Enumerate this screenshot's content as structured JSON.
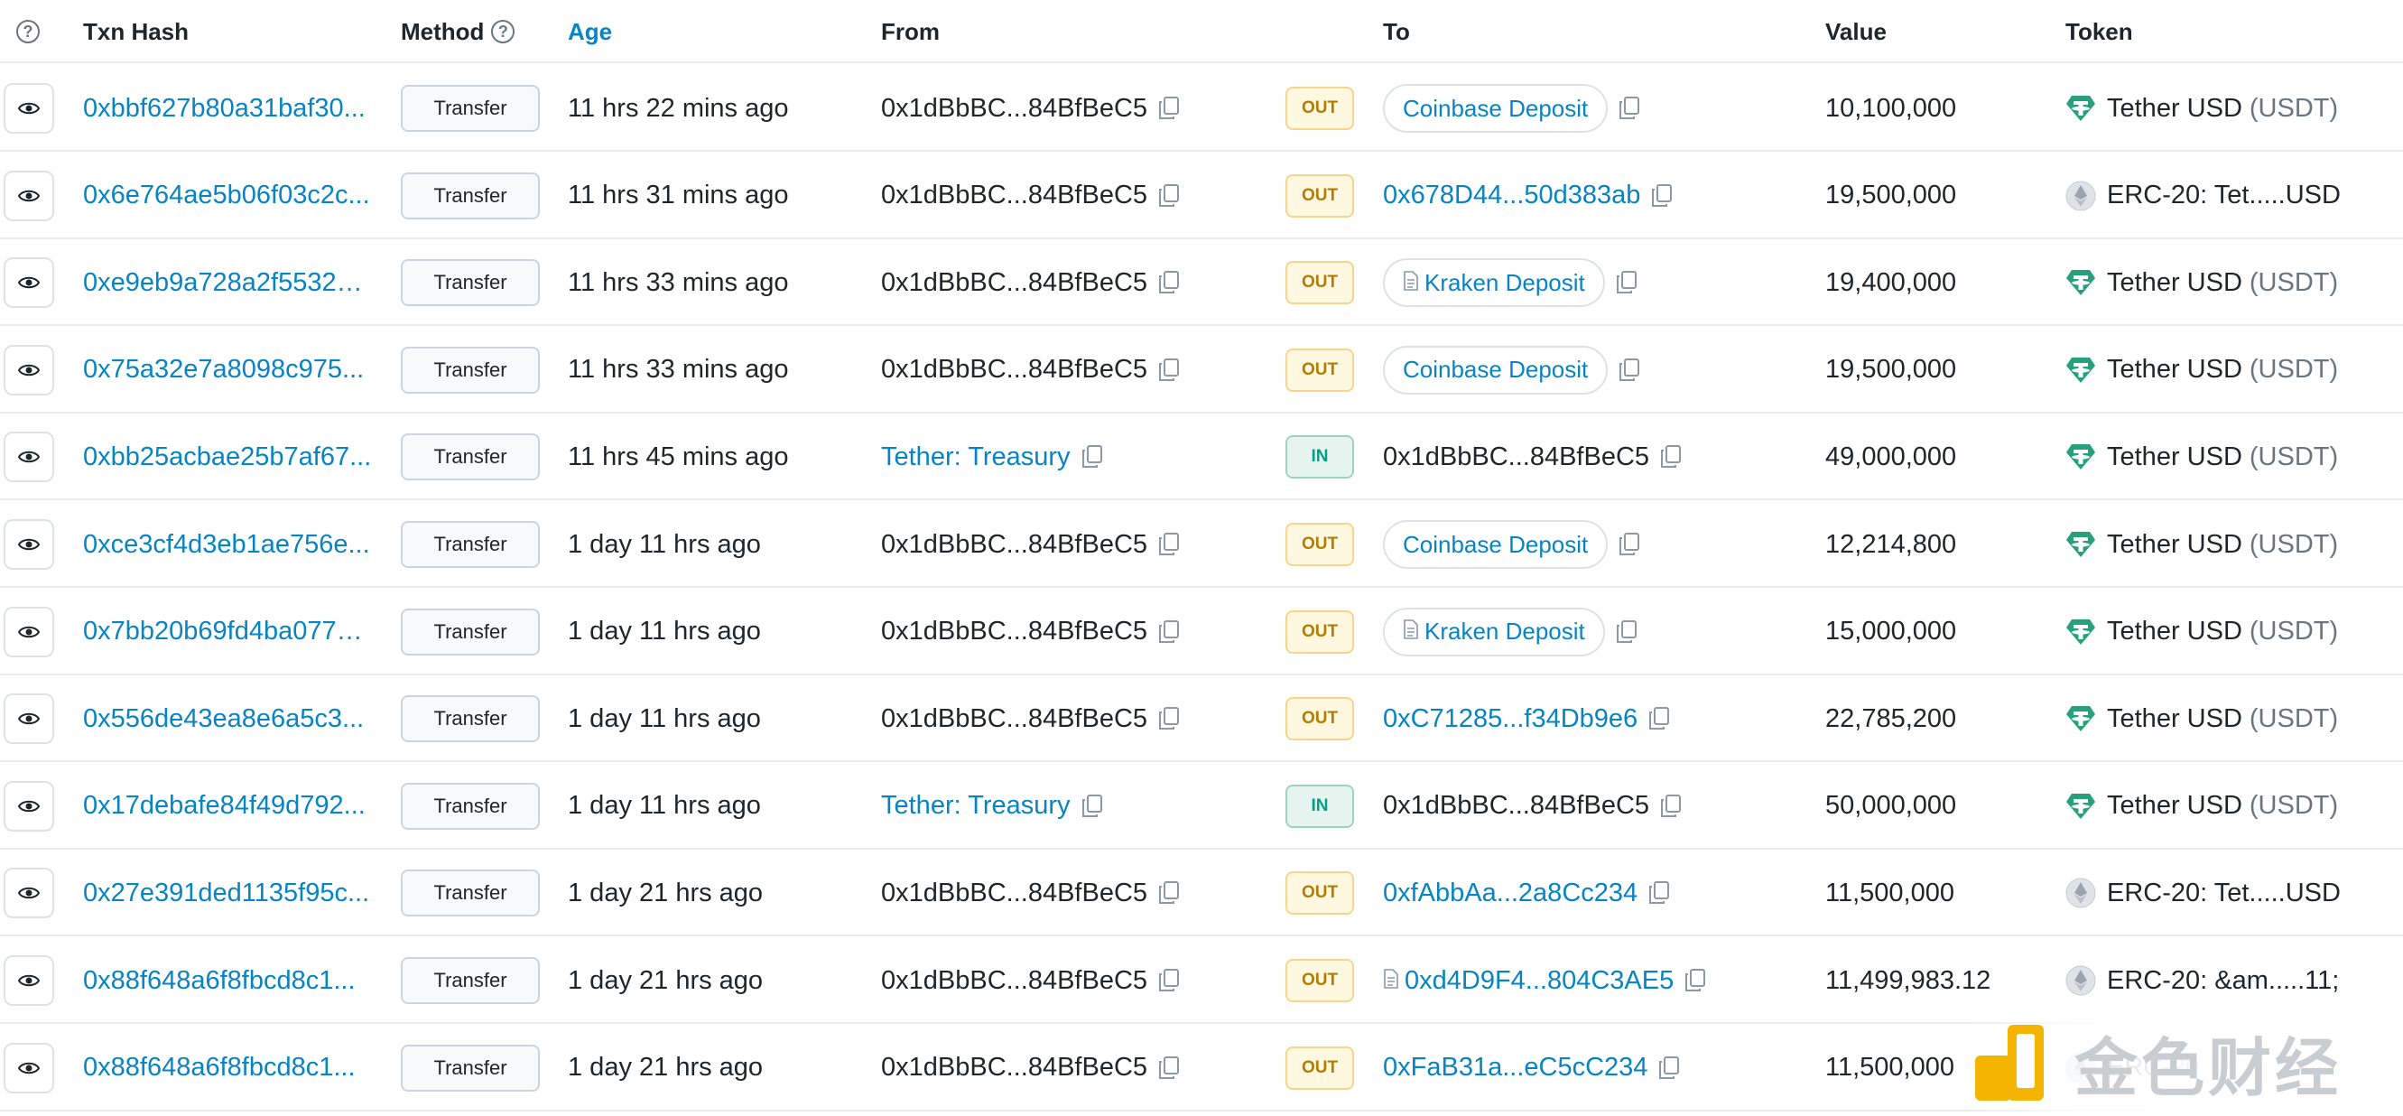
{
  "columns": {
    "help": "?",
    "txn_hash": "Txn Hash",
    "method": "Method",
    "age": "Age",
    "from": "From",
    "to": "To",
    "value": "Value",
    "token": "Token"
  },
  "rows": [
    {
      "hash": "0xbbf627b80a31baf30...",
      "method": "Transfer",
      "age": "11 hrs 22 mins ago",
      "from": "0x1dBbBC...84BfBeC5",
      "from_link": false,
      "dir": "OUT",
      "to": "Coinbase Deposit",
      "to_type": "pill",
      "value": "10,100,000",
      "token_type": "tether",
      "token_name": "Tether USD",
      "token_sym": "(USDT)"
    },
    {
      "hash": "0x6e764ae5b06f03c2c...",
      "method": "Transfer",
      "age": "11 hrs 31 mins ago",
      "from": "0x1dBbBC...84BfBeC5",
      "from_link": false,
      "dir": "OUT",
      "to": "0x678D44...50d383ab",
      "to_type": "link",
      "value": "19,500,000",
      "token_type": "erc20",
      "token_name": "ERC-20: Tet.....USD",
      "token_sym": ""
    },
    {
      "hash": "0xe9eb9a728a2f55325...",
      "method": "Transfer",
      "age": "11 hrs 33 mins ago",
      "from": "0x1dBbBC...84BfBeC5",
      "from_link": false,
      "dir": "OUT",
      "to": "Kraken Deposit",
      "to_type": "pill-doc",
      "value": "19,400,000",
      "token_type": "tether",
      "token_name": "Tether USD",
      "token_sym": "(USDT)"
    },
    {
      "hash": "0x75a32e7a8098c975...",
      "method": "Transfer",
      "age": "11 hrs 33 mins ago",
      "from": "0x1dBbBC...84BfBeC5",
      "from_link": false,
      "dir": "OUT",
      "to": "Coinbase Deposit",
      "to_type": "pill",
      "value": "19,500,000",
      "token_type": "tether",
      "token_name": "Tether USD",
      "token_sym": "(USDT)"
    },
    {
      "hash": "0xbb25acbae25b7af67...",
      "method": "Transfer",
      "age": "11 hrs 45 mins ago",
      "from": "Tether: Treasury",
      "from_link": true,
      "dir": "IN",
      "to": "0x1dBbBC...84BfBeC5",
      "to_type": "plain",
      "value": "49,000,000",
      "token_type": "tether",
      "token_name": "Tether USD",
      "token_sym": "(USDT)"
    },
    {
      "hash": "0xce3cf4d3eb1ae756e...",
      "method": "Transfer",
      "age": "1 day 11 hrs ago",
      "from": "0x1dBbBC...84BfBeC5",
      "from_link": false,
      "dir": "OUT",
      "to": "Coinbase Deposit",
      "to_type": "pill",
      "value": "12,214,800",
      "token_type": "tether",
      "token_name": "Tether USD",
      "token_sym": "(USDT)"
    },
    {
      "hash": "0x7bb20b69fd4ba0779...",
      "method": "Transfer",
      "age": "1 day 11 hrs ago",
      "from": "0x1dBbBC...84BfBeC5",
      "from_link": false,
      "dir": "OUT",
      "to": "Kraken Deposit",
      "to_type": "pill-doc",
      "value": "15,000,000",
      "token_type": "tether",
      "token_name": "Tether USD",
      "token_sym": "(USDT)"
    },
    {
      "hash": "0x556de43ea8e6a5c3...",
      "method": "Transfer",
      "age": "1 day 11 hrs ago",
      "from": "0x1dBbBC...84BfBeC5",
      "from_link": false,
      "dir": "OUT",
      "to": "0xC71285...f34Db9e6",
      "to_type": "link",
      "value": "22,785,200",
      "token_type": "tether",
      "token_name": "Tether USD",
      "token_sym": "(USDT)"
    },
    {
      "hash": "0x17debafe84f49d792...",
      "method": "Transfer",
      "age": "1 day 11 hrs ago",
      "from": "Tether: Treasury",
      "from_link": true,
      "dir": "IN",
      "to": "0x1dBbBC...84BfBeC5",
      "to_type": "plain",
      "value": "50,000,000",
      "token_type": "tether",
      "token_name": "Tether USD",
      "token_sym": "(USDT)"
    },
    {
      "hash": "0x27e391ded1135f95c...",
      "method": "Transfer",
      "age": "1 day 21 hrs ago",
      "from": "0x1dBbBC...84BfBeC5",
      "from_link": false,
      "dir": "OUT",
      "to": "0xfAbbAa...2a8Cc234",
      "to_type": "link",
      "value": "11,500,000",
      "token_type": "erc20",
      "token_name": "ERC-20: Tet.....USD",
      "token_sym": ""
    },
    {
      "hash": "0x88f648a6f8fbcd8c1...",
      "method": "Transfer",
      "age": "1 day 21 hrs ago",
      "from": "0x1dBbBC...84BfBeC5",
      "from_link": false,
      "dir": "OUT",
      "to": "0xd4D9F4...804C3AE5",
      "to_type": "link-doc",
      "value": "11,499,983.12",
      "token_type": "erc20",
      "token_name": "ERC-20: &am.....11;",
      "token_sym": ""
    },
    {
      "hash": "0x88f648a6f8fbcd8c1...",
      "method": "Transfer",
      "age": "1 day 21 hrs ago",
      "from": "0x1dBbBC...84BfBeC5",
      "from_link": false,
      "dir": "OUT",
      "to": "0xFaB31a...eC5cC234",
      "to_type": "link",
      "value": "11,500,000",
      "token_type": "erc20",
      "token_name": "ERC-20 &am.....11",
      "token_sym": ""
    }
  ],
  "watermark": {
    "text": "金色财经"
  },
  "colors": {
    "link": "#0784c3",
    "out": "#b47d00",
    "in": "#00a186",
    "tether": "#26a17b"
  }
}
